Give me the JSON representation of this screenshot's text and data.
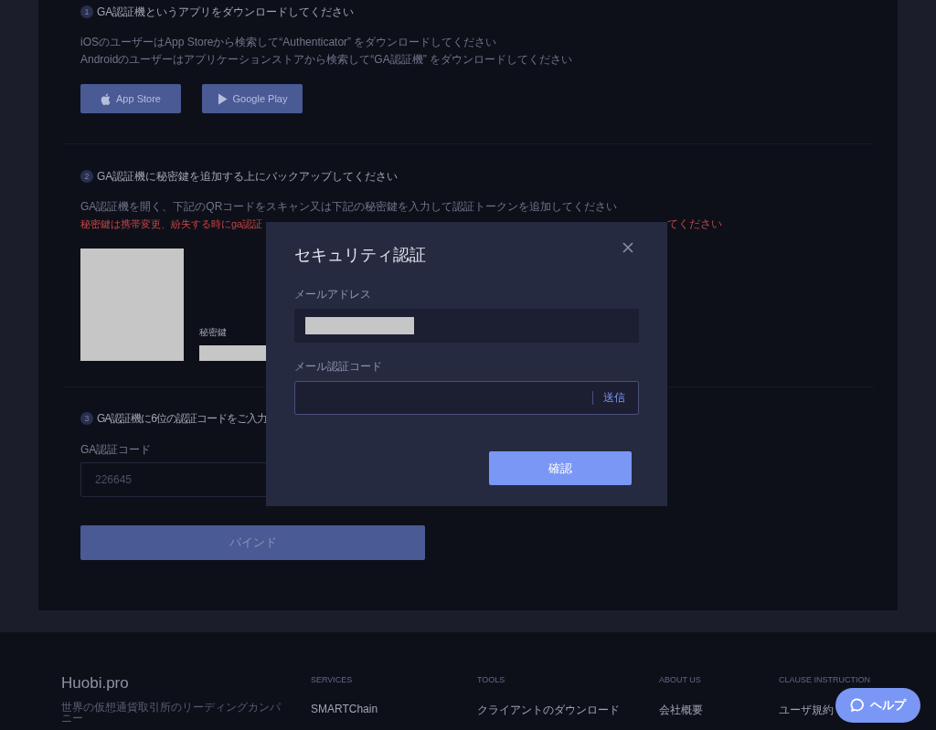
{
  "steps": [
    {
      "number": "1",
      "title": "GA認証機というアプリをダウンロードしてください",
      "lines": [
        {
          "text": "iOSのユーザーはApp Storeから検索して“Authenticator” をダウンロードしてください",
          "kind": "normal"
        },
        {
          "text": "Androidのユーザーはアプリケーションストアから検索して“GA認証機” をダウンロードしてください",
          "kind": "normal"
        }
      ],
      "store_buttons": [
        {
          "label": "App Store",
          "kind": "apple"
        },
        {
          "label": "Google Play",
          "kind": "play"
        }
      ]
    },
    {
      "number": "2",
      "title": "GA認証機に秘密鍵を追加する上にバックアップしてください",
      "lines": [
        {
          "text": "GA認証機を開く、下記のQRコードをスキャン又は下記の秘密鍵を入力して認証トークンを追加してください",
          "kind": "normal"
        },
        {
          "text": "秘密鍵は携帯変更、紛失する時にga認証",
          "kind": "warning",
          "tail": "てください"
        }
      ],
      "secret_key_label": "秘密鍵"
    },
    {
      "number": "3",
      "title": "GA認証機に6位の認証コードをご入力",
      "code_label": "GA認証コード",
      "code_value": "226645",
      "bind_button": "バインド"
    }
  ],
  "modal": {
    "title": "セキュリティ認証",
    "email_label": "メールアドレス",
    "code_label": "メール認証コード",
    "send_link": "送信",
    "confirm_button": "確認"
  },
  "footer": {
    "brand": "Huobi.pro",
    "tagline": "世界の仮想通貨取引所のリーディングカンパニー",
    "columns": [
      {
        "heading": "SERVICES",
        "items": [
          "SMARTChain"
        ]
      },
      {
        "heading": "TOOLS",
        "items": [
          "クライアントのダウンロード"
        ]
      },
      {
        "heading": "ABOUT US",
        "items": [
          "会社概要"
        ]
      },
      {
        "heading": "CLAUSE INSTRUCTION",
        "items": [
          "ユーザ規約"
        ]
      }
    ]
  },
  "help_button": "ヘルプ"
}
